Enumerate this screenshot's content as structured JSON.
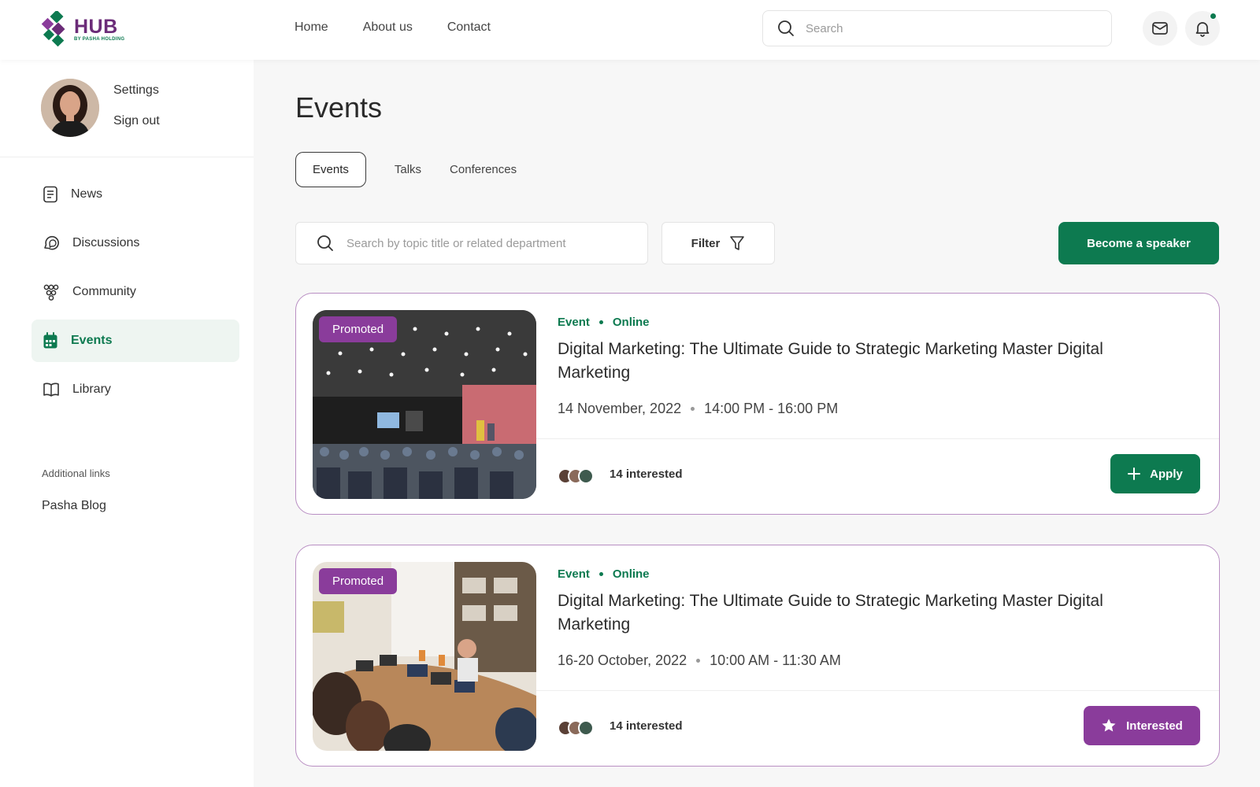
{
  "app": {
    "logo_text": "HUB",
    "logo_sub": "BY PASHA HOLDING",
    "nav": [
      "Home",
      "About us",
      "Contact"
    ],
    "search_placeholder": "Search"
  },
  "profile": {
    "settings": "Settings",
    "signout": "Sign out"
  },
  "sidebar": {
    "items": [
      {
        "label": "News",
        "icon": "news-icon"
      },
      {
        "label": "Discussions",
        "icon": "discussions-icon"
      },
      {
        "label": "Community",
        "icon": "community-icon"
      },
      {
        "label": "Events",
        "icon": "calendar-icon",
        "active": true
      },
      {
        "label": "Library",
        "icon": "book-icon"
      }
    ],
    "additional_title": "Additional links",
    "additional_links": [
      "Pasha Blog"
    ]
  },
  "page": {
    "title": "Events",
    "tabs": [
      "Events",
      "Talks",
      "Conferences"
    ],
    "active_tab": "Events",
    "search_placeholder": "Search by topic title or related department",
    "filter_label": "Filter",
    "speaker_button": "Become a speaker"
  },
  "events": [
    {
      "badge": "Promoted",
      "type": "Event",
      "mode": "Online",
      "title": "Digital Marketing: The Ultimate Guide to Strategic Marketing Master Digital Marketing",
      "date": "14 November, 2022",
      "time": "14:00 PM - 16:00 PM",
      "interested": "14 interested",
      "action": "Apply"
    },
    {
      "badge": "Promoted",
      "type": "Event",
      "mode": "Online",
      "title": "Digital Marketing: The Ultimate Guide to Strategic Marketing Master Digital Marketing",
      "date": "16-20 October, 2022",
      "time": "10:00 AM - 11:30 AM",
      "interested": "14 interested",
      "action": "Interested"
    }
  ],
  "colors": {
    "brand_green": "#0d7a50",
    "brand_purple": "#8a3c9b",
    "card_border": "#b98fc3"
  }
}
